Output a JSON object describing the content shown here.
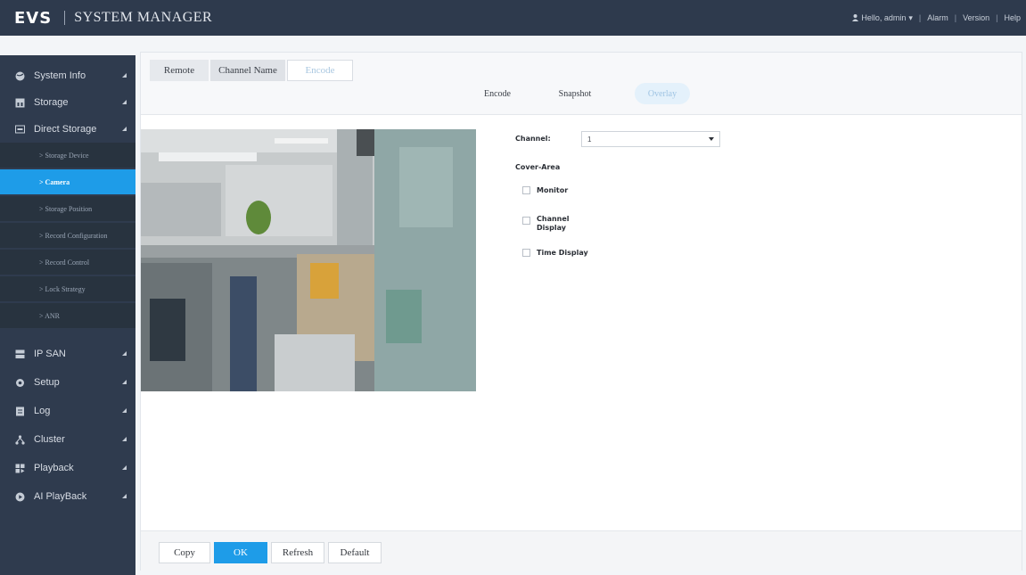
{
  "header": {
    "logo": "EVS",
    "title": "SYSTEM MANAGER",
    "user": "Hello, admin",
    "links": [
      "Alarm",
      "Version",
      "Help"
    ]
  },
  "sidebar": {
    "items": [
      {
        "label": "System Info",
        "icon": "globe-icon"
      },
      {
        "label": "Storage",
        "icon": "storage-icon"
      },
      {
        "label": "Direct Storage",
        "icon": "direct-storage-icon"
      },
      {
        "label": "IP SAN",
        "icon": "ip-san-icon"
      },
      {
        "label": "Setup",
        "icon": "gear-icon"
      },
      {
        "label": "Log",
        "icon": "log-icon"
      },
      {
        "label": "Cluster",
        "icon": "cluster-icon"
      },
      {
        "label": "Playback",
        "icon": "playback-icon"
      },
      {
        "label": "AI PlayBack",
        "icon": "ai-playback-icon"
      }
    ],
    "sub_items": [
      {
        "label": "> Storage Device",
        "active": false
      },
      {
        "label": "> Camera",
        "active": true
      },
      {
        "label": "> Storage Position",
        "active": false
      },
      {
        "label": "> Record Configuration",
        "active": false
      },
      {
        "label": "> Record Control",
        "active": false
      },
      {
        "label": "> Lock Strategy",
        "active": false
      },
      {
        "label": "> ANR",
        "active": false
      }
    ]
  },
  "tabs": {
    "top": [
      "Remote",
      "Channel Name",
      "Encode"
    ],
    "active_top": "Encode",
    "sub": [
      "Encode",
      "Snapshot",
      "Overlay"
    ],
    "active_sub": "Overlay"
  },
  "form": {
    "channel_label": "Channel:",
    "channel_value": "1",
    "cover_area_label": "Cover-Area",
    "checkboxes": [
      {
        "label": "Monitor",
        "checked": false
      },
      {
        "label": "Channel Display",
        "checked": false
      },
      {
        "label": "Time Display",
        "checked": false
      }
    ]
  },
  "buttons": {
    "copy": "Copy",
    "ok": "OK",
    "refresh": "Refresh",
    "default": "Default"
  },
  "colors": {
    "header_bg": "#2e3a4d",
    "sidebar_bg": "#2f3b4e",
    "accent": "#1e9ce8"
  }
}
